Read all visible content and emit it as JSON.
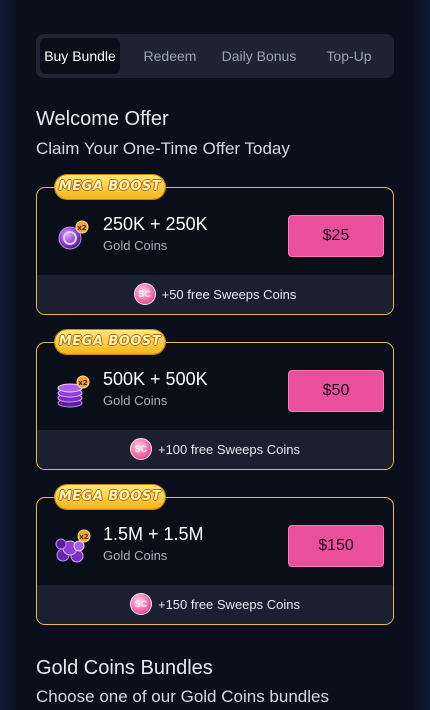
{
  "tabs": [
    {
      "label": "Buy Bundle",
      "active": true
    },
    {
      "label": "Redeem",
      "active": false
    },
    {
      "label": "Daily Bonus",
      "active": false
    },
    {
      "label": "Top-Up",
      "active": false
    }
  ],
  "welcome": {
    "title": "Welcome Offer",
    "subtitle": "Claim Your One-Time Offer Today"
  },
  "offers": [
    {
      "badge": "MEGA BOOST",
      "amount": "250K + 250K",
      "currency": "Gold Coins",
      "price": "$25",
      "bonus": "+50 free Sweeps Coins",
      "bonus_icon": "SC",
      "icon": "gold-coin-x2-icon"
    },
    {
      "badge": "MEGA BOOST",
      "amount": "500K + 500K",
      "currency": "Gold Coins",
      "price": "$50",
      "bonus": "+100 free Sweeps Coins",
      "bonus_icon": "SC",
      "icon": "coin-stack-x2-icon"
    },
    {
      "badge": "MEGA BOOST",
      "amount": "1.5M + 1.5M",
      "currency": "Gold Coins",
      "price": "$150",
      "bonus": "+150 free Sweeps Coins",
      "bonus_icon": "SC",
      "icon": "coin-pile-x2-icon"
    }
  ],
  "bundles": {
    "title": "Gold Coins Bundles",
    "subtitle": "Choose one of our Gold Coins bundles"
  },
  "colors": {
    "accent_pink": "#ea4f9c",
    "card_border": "#e8b84a",
    "background": "#0b0f1c"
  }
}
